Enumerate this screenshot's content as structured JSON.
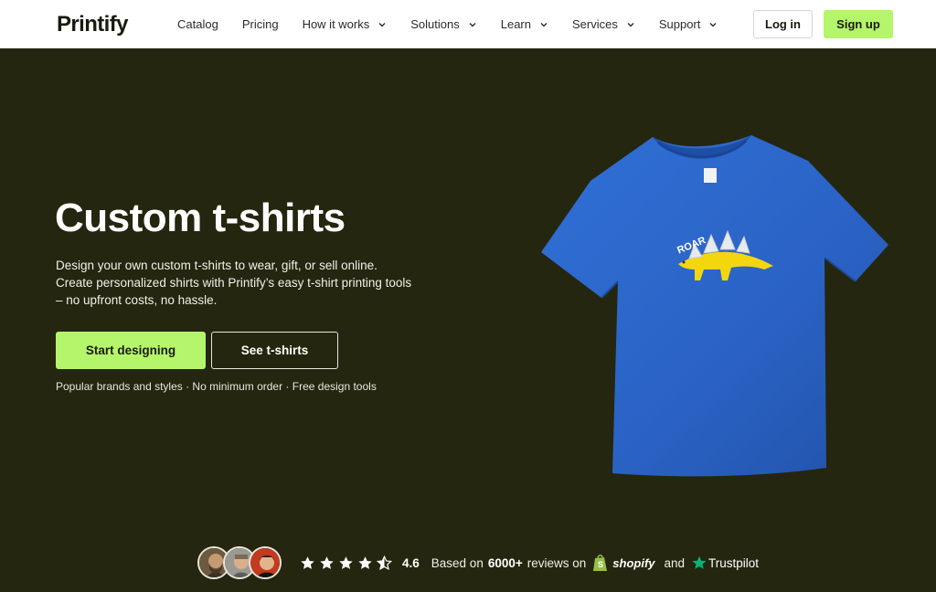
{
  "brand": {
    "logo_text": "Printify"
  },
  "nav": {
    "items": [
      {
        "label": "Catalog",
        "has_dropdown": false
      },
      {
        "label": "Pricing",
        "has_dropdown": false
      },
      {
        "label": "How it works",
        "has_dropdown": true
      },
      {
        "label": "Solutions",
        "has_dropdown": true
      },
      {
        "label": "Learn",
        "has_dropdown": true
      },
      {
        "label": "Services",
        "has_dropdown": true
      },
      {
        "label": "Support",
        "has_dropdown": true
      }
    ],
    "login_label": "Log in",
    "signup_label": "Sign up"
  },
  "hero": {
    "title": "Custom t-shirts",
    "description": "Design your own custom t-shirts to wear, gift, or sell online. Create personalized shirts with Printify’s easy t-shirt printing tools – no upfront costs, no hassle.",
    "primary_button": "Start designing",
    "secondary_button": "See t-shirts",
    "features": "Popular brands and styles · No minimum order · Free design tools",
    "shirt_print_text": "ROAR"
  },
  "rating": {
    "stars": 4.5,
    "score": "4.6",
    "based_on": "Based on",
    "count": "6000+",
    "reviews_on": "reviews on",
    "shopify_label": "shopify",
    "and": "and",
    "trustpilot_label": "Trustpilot"
  },
  "colors": {
    "background": "#25260f",
    "accent": "#b5f56b",
    "shirt": "#2a62c4",
    "trustpilot": "#00b67a",
    "shopify": "#95bf47"
  }
}
